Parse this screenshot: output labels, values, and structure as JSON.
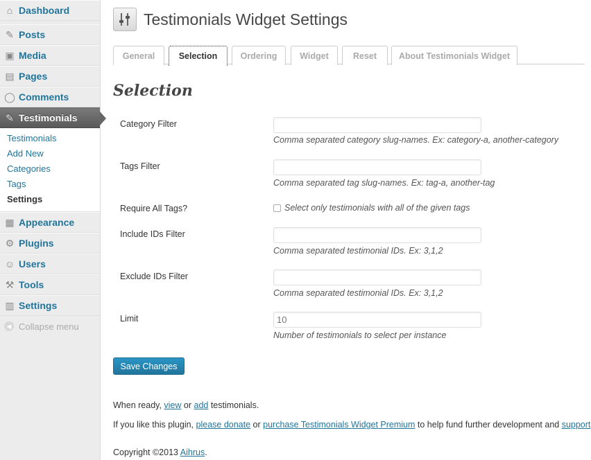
{
  "sidebar": {
    "items_top": [
      {
        "label": "Dashboard",
        "icon": "dashboard-icon",
        "glyph": "⌂"
      }
    ],
    "items_mid": [
      {
        "label": "Posts",
        "icon": "pin-icon",
        "glyph": "✎"
      },
      {
        "label": "Media",
        "icon": "media-icon",
        "glyph": "▣"
      },
      {
        "label": "Pages",
        "icon": "pages-icon",
        "glyph": "▤"
      },
      {
        "label": "Comments",
        "icon": "comments-icon",
        "glyph": "◯"
      }
    ],
    "testimonials": {
      "label": "Testimonials",
      "icon": "pin-icon",
      "glyph": "✎"
    },
    "submenu": [
      "Testimonials",
      "Add New",
      "Categories",
      "Tags",
      "Settings"
    ],
    "items_bottom": [
      {
        "label": "Appearance",
        "icon": "appearance-icon",
        "glyph": "▦"
      },
      {
        "label": "Plugins",
        "icon": "plugins-icon",
        "glyph": "⚙"
      },
      {
        "label": "Users",
        "icon": "users-icon",
        "glyph": "☺"
      },
      {
        "label": "Tools",
        "icon": "tools-icon",
        "glyph": "⚒"
      },
      {
        "label": "Settings",
        "icon": "settings-icon",
        "glyph": "▥"
      }
    ],
    "collapse": "Collapse menu"
  },
  "page": {
    "title": "Testimonials Widget Settings",
    "tabs": [
      "General",
      "Selection",
      "Ordering",
      "Widget",
      "Reset",
      "About Testimonials Widget"
    ],
    "active_tab": "Selection",
    "section_title": "Selection"
  },
  "form": {
    "category_filter": {
      "label": "Category Filter",
      "value": "",
      "desc": "Comma separated category slug-names. Ex: category-a, another-category"
    },
    "tags_filter": {
      "label": "Tags Filter",
      "value": "",
      "desc": "Comma separated tag slug-names. Ex: tag-a, another-tag"
    },
    "require_all_tags": {
      "label": "Require All Tags?",
      "checkbox_label": "Select only testimonials with all of the given tags",
      "checked": false
    },
    "include_ids": {
      "label": "Include IDs Filter",
      "value": "",
      "desc": "Comma separated testimonial IDs. Ex: 3,1,2"
    },
    "exclude_ids": {
      "label": "Exclude IDs Filter",
      "value": "",
      "desc": "Comma separated testimonial IDs. Ex: 3,1,2"
    },
    "limit": {
      "label": "Limit",
      "placeholder": "10",
      "desc": "Number of testimonials to select per instance"
    },
    "save_button": "Save Changes"
  },
  "footer": {
    "ready": {
      "before": "When ready, ",
      "view": "view",
      "or": " or ",
      "add": "add",
      "after": " testimonials."
    },
    "donate": {
      "before": "If you like this plugin, ",
      "donate": "please donate",
      "or": " or ",
      "premium": "purchase Testimonials Widget Premium",
      "middle": " to help fund further development and ",
      "support": "support",
      "after": "."
    },
    "copyright": {
      "before": "Copyright ©2013 ",
      "link": "Aihrus",
      "after": "."
    }
  },
  "colors": {
    "link": "#21759b",
    "button": "#21759b",
    "current_menu": "#666666"
  }
}
